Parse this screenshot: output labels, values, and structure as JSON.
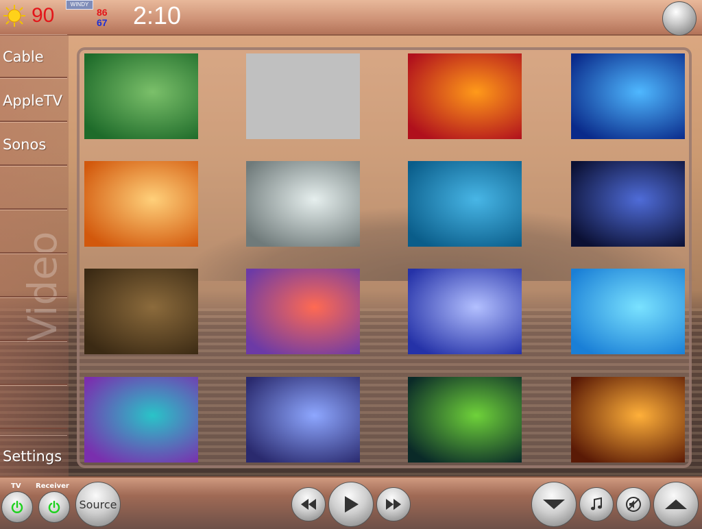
{
  "weather": {
    "icon": "sun-icon",
    "current_temp": "90",
    "condition_badge": "WINDY",
    "high": "86",
    "low": "67",
    "temp_color_hi": "#e3161a",
    "temp_color_lo": "#1b2fd6"
  },
  "clock": "2:10",
  "sidebar": {
    "items": [
      {
        "label": "Cable"
      },
      {
        "label": "AppleTV"
      },
      {
        "label": "Sonos"
      },
      {
        "label": ""
      },
      {
        "label": ""
      },
      {
        "label": ""
      },
      {
        "label": ""
      },
      {
        "label": ""
      },
      {
        "label": ""
      },
      {
        "label": "Settings"
      }
    ],
    "watermark": "Video"
  },
  "gallery": {
    "thumbnails": [
      {
        "name": "anemone-clownfish",
        "colors": [
          "#1e6b2a",
          "#7bc06a"
        ]
      },
      {
        "name": "blank-gray",
        "colors": [
          "#c0c0c0",
          "#c0c0c0"
        ]
      },
      {
        "name": "red-fireball",
        "colors": [
          "#b0101c",
          "#ff9a1a"
        ]
      },
      {
        "name": "blue-streaks",
        "colors": [
          "#0a2a8a",
          "#4fb8ff"
        ]
      },
      {
        "name": "orange-glow",
        "colors": [
          "#d2580c",
          "#ffd07a"
        ]
      },
      {
        "name": "silver-bubbles",
        "colors": [
          "#6f7a7a",
          "#e6efee"
        ]
      },
      {
        "name": "teal-swoosh",
        "colors": [
          "#0a5d8a",
          "#48b6e6"
        ]
      },
      {
        "name": "blue-fractal",
        "colors": [
          "#0b1033",
          "#4f6cd8"
        ]
      },
      {
        "name": "brown-pattern",
        "colors": [
          "#3b2a14",
          "#8c6b3c"
        ]
      },
      {
        "name": "purple-pink-cloud",
        "colors": [
          "#6c3aa6",
          "#ff6a52"
        ]
      },
      {
        "name": "blue-aurora",
        "colors": [
          "#2532a8",
          "#b3c0ff"
        ]
      },
      {
        "name": "cyan-wave",
        "colors": [
          "#1a7fd6",
          "#7ae2ff"
        ]
      },
      {
        "name": "rainbow-wave",
        "colors": [
          "#7a2fae",
          "#29c4c8"
        ]
      },
      {
        "name": "blue-droplets",
        "colors": [
          "#2a2a6e",
          "#8ea7ff"
        ]
      },
      {
        "name": "green-curve",
        "colors": [
          "#0a2a28",
          "#6fd23a"
        ]
      },
      {
        "name": "island-sunset",
        "colors": [
          "#5a1a06",
          "#ffb03a"
        ]
      }
    ]
  },
  "bottom": {
    "tv_label": "TV",
    "receiver_label": "Receiver",
    "source_label": "Source",
    "power_color": "#1fd11f",
    "icons": {
      "rewind": "rewind-icon",
      "play": "play-icon",
      "fast_forward": "fast-forward-icon",
      "volume_down": "chevron-down-icon",
      "music": "music-note-icon",
      "mute": "mute-icon",
      "volume_up": "chevron-up-icon"
    }
  }
}
